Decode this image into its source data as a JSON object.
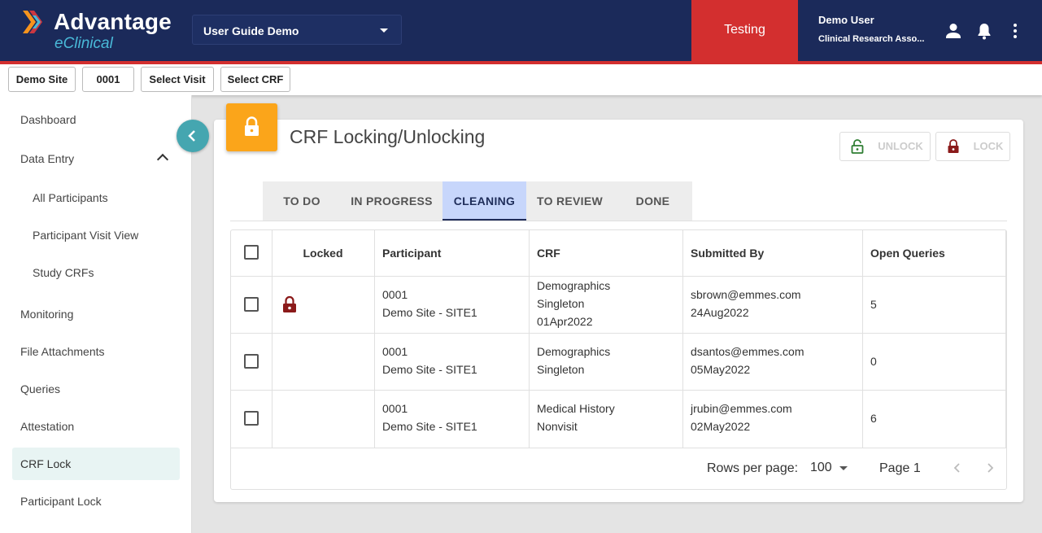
{
  "app": {
    "brand": "Advantage",
    "brand_sub": "eClinical",
    "study_label": "User Guide Demo",
    "environment": "Testing",
    "user_name": "Demo User",
    "user_role": "Clinical Research Asso...",
    "colors": {
      "header": "#1b2a5a",
      "environment": "#d32f2f",
      "accent": "#45a6b0",
      "card_icon": "#fba51a",
      "active_tab": "#c7d6fb"
    }
  },
  "context_bar": {
    "site": "Demo Site",
    "participant": "0001",
    "visit": "Select Visit",
    "crf": "Select CRF"
  },
  "sidebar": {
    "items": [
      {
        "label": "Dashboard"
      },
      {
        "label": "Data Entry"
      },
      {
        "label": "All Participants"
      },
      {
        "label": "Participant Visit View"
      },
      {
        "label": "Study CRFs"
      },
      {
        "label": "Monitoring"
      },
      {
        "label": "File Attachments"
      },
      {
        "label": "Queries"
      },
      {
        "label": "Attestation"
      },
      {
        "label": "CRF Lock"
      },
      {
        "label": "Participant Lock"
      }
    ]
  },
  "page": {
    "title": "CRF Locking/Unlocking",
    "unlock_label": "UNLOCK",
    "lock_label": "LOCK",
    "tabs": [
      {
        "label": "TO DO"
      },
      {
        "label": "IN PROGRESS"
      },
      {
        "label": "CLEANING"
      },
      {
        "label": "TO REVIEW"
      },
      {
        "label": "DONE"
      }
    ],
    "active_tab": "CLEANING"
  },
  "table": {
    "headers": [
      "Locked",
      "Participant",
      "CRF",
      "Submitted By",
      "Open Queries"
    ],
    "rows": [
      {
        "locked": true,
        "participant_id": "0001",
        "participant_site": "Demo Site - SITE1",
        "crf_lines": [
          "Demographics",
          "Singleton",
          "01Apr2022"
        ],
        "submitted_by": "sbrown@emmes.com",
        "submitted_date": "24Aug2022",
        "open_queries": "5"
      },
      {
        "locked": false,
        "participant_id": "0001",
        "participant_site": "Demo Site - SITE1",
        "crf_lines": [
          "Demographics",
          "Singleton"
        ],
        "submitted_by": "dsantos@emmes.com",
        "submitted_date": "05May2022",
        "open_queries": "0"
      },
      {
        "locked": false,
        "participant_id": "0001",
        "participant_site": "Demo Site - SITE1",
        "crf_lines": [
          "Medical History",
          "Nonvisit"
        ],
        "submitted_by": "jrubin@emmes.com",
        "submitted_date": "02May2022",
        "open_queries": "6"
      }
    ],
    "rows_per_page_label": "Rows per page:",
    "rows_per_page": "100",
    "page_label": "Page 1"
  }
}
